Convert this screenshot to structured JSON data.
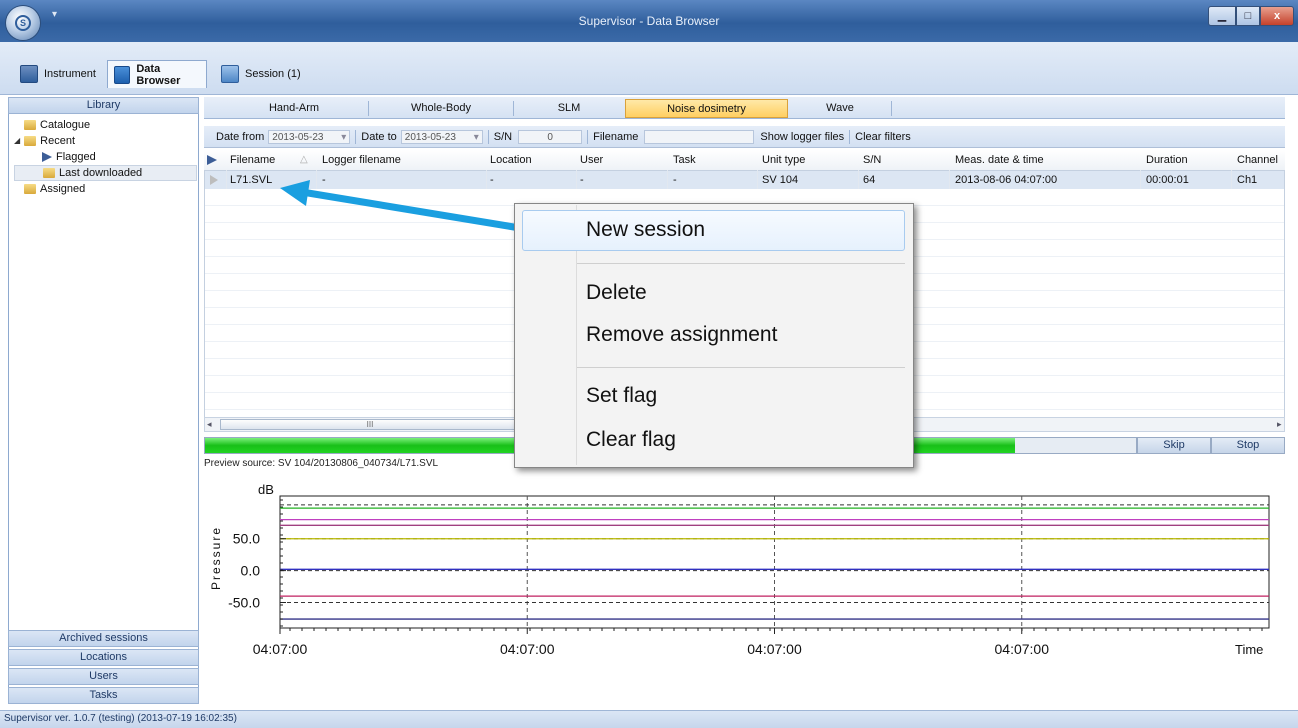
{
  "window": {
    "title": "Supervisor - Data Browser",
    "minimize_glyph": "▁",
    "maximize_glyph": "□",
    "close_glyph": "x",
    "qat_glyph": "▾"
  },
  "ribbon": {
    "tabs": [
      {
        "label": "Instrument",
        "icon": "instrument-icon"
      },
      {
        "label": "Data Browser",
        "icon": "data-browser-icon"
      },
      {
        "label": "Session (1)",
        "icon": "session-icon"
      }
    ]
  },
  "library": {
    "header": "Library",
    "tree": [
      {
        "label": "Catalogue"
      },
      {
        "label": "Recent"
      },
      {
        "label": "Flagged"
      },
      {
        "label": "Last downloaded"
      },
      {
        "label": "Assigned"
      }
    ],
    "bottom_sections": [
      "Archived sessions",
      "Locations",
      "Users",
      "Tasks"
    ]
  },
  "type_tabs": [
    "Hand-Arm",
    "Whole-Body",
    "SLM",
    "Noise dosimetry",
    "Wave"
  ],
  "filters": {
    "date_from_label": "Date from",
    "date_from_value": "2013-05-23",
    "date_to_label": "Date to",
    "date_to_value": "2013-05-23",
    "sn_label": "S/N",
    "sn_value": "0",
    "filename_label": "Filename",
    "filename_value": "",
    "show_logger_files": "Show logger files",
    "clear_filters": "Clear filters"
  },
  "grid": {
    "columns": [
      "Filename",
      "Logger filename",
      "Location",
      "User",
      "Task",
      "Unit type",
      "S/N",
      "Meas. date & time",
      "Duration",
      "Channel"
    ],
    "rows": [
      [
        "L71.SVL",
        "-",
        "-",
        "-",
        "-",
        "SV 104",
        "64",
        "2013-08-06 04:07:00",
        "00:00:01",
        "Ch1"
      ]
    ],
    "scroll_mark": "III"
  },
  "progress": {
    "fraction": 0.87,
    "skip_label": "Skip",
    "stop_label": "Stop"
  },
  "preview_source": "Preview source: SV 104/20130806_040734/L71.SVL",
  "context_menu": {
    "items": [
      "New session",
      "Delete",
      "Remove assignment",
      "Set flag",
      "Clear flag"
    ]
  },
  "chart_data": {
    "type": "line",
    "ylabel": "Pressure",
    "yunit": "dB",
    "xlabel": "Time",
    "yticks": [
      50.0,
      0.0,
      -50.0
    ],
    "ytick_labels": [
      "50.0",
      "0.0",
      "-50.0"
    ],
    "xtick_labels": [
      "04:07:00",
      "04:07:00",
      "04:07:00",
      "04:07:00"
    ],
    "ylim": [
      -90,
      117
    ],
    "series": [
      {
        "color": "#22b022",
        "values": [
          98,
          98
        ]
      },
      {
        "color": "#c040c0",
        "values": [
          80,
          80
        ]
      },
      {
        "color": "#a04080",
        "values": [
          71,
          71
        ]
      },
      {
        "color": "#b8b800",
        "values": [
          50,
          50
        ]
      },
      {
        "color": "#3030c0",
        "values": [
          2,
          2
        ]
      },
      {
        "color": "#c02060",
        "values": [
          -40,
          -40
        ]
      },
      {
        "color": "#333388",
        "values": [
          -76,
          -76
        ]
      }
    ],
    "ref_lines": [
      103,
      50,
      0,
      -50
    ],
    "grid": true
  },
  "status": {
    "version": "Supervisor ver. 1.0.7 (testing) (2013-07-19 16:02:35)"
  }
}
